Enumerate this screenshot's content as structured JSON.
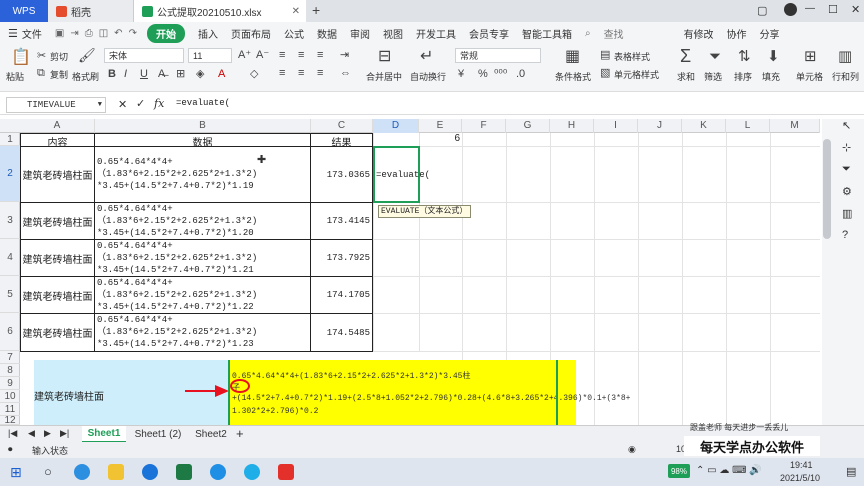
{
  "titlebar": {
    "wps_label": "WPS",
    "tab_daoke": "稻壳",
    "tab_file": "公式提取20210510.xlsx",
    "new_tab": "+",
    "win_ctrl_restore": "▢",
    "win_ctrl_min": "—",
    "win_ctrl_max": "☐",
    "win_ctrl_close": "✕"
  },
  "menubar": {
    "file": "文件",
    "items": [
      "开始",
      "插入",
      "页面布局",
      "公式",
      "数据",
      "审阅",
      "视图",
      "开发工具",
      "会员专享",
      "智能工具箱"
    ],
    "search": "查找",
    "right": [
      "有修改",
      "协作",
      "分享"
    ]
  },
  "ribbon": {
    "paste": "粘贴",
    "cut": "剪切",
    "copy": "复制",
    "format_painter": "格式刷",
    "font_name": "宋体",
    "font_size": "11",
    "merge": "合并居中",
    "wrap": "自动换行",
    "number_format": "常规",
    "table_style": "表格样式",
    "cond_format": "条件格式",
    "cell_style": "单元格样式",
    "sum": "求和",
    "filter": "筛选",
    "sort": "排序",
    "fill": "填充",
    "cell_fmt": "单元格",
    "row_col": "行和列"
  },
  "formula_bar": {
    "name_box": "TIMEVALUE",
    "formula": "=evaluate("
  },
  "columns": [
    "A",
    "B",
    "C",
    "D",
    "E",
    "F",
    "G",
    "H",
    "I",
    "J",
    "K",
    "L",
    "M"
  ],
  "rows": [
    "1",
    "2",
    "3",
    "4",
    "5",
    "6",
    "7",
    "8",
    "9",
    "10",
    "11",
    "12"
  ],
  "header_row": {
    "a": "内容",
    "b": "数据",
    "c": "结果",
    "e": "6"
  },
  "data_rows": [
    {
      "a": "建筑老砖墙柱面",
      "b1": "0.65*4.64*4*4+",
      "b2": "（1.83*6+2.15*2+2.625*2+1.3*2)",
      "b3": "*3.45+(14.5*2+7.4+0.7*2)*1.19",
      "c": "173.0365"
    },
    {
      "a": "建筑老砖墙柱面",
      "b1": "0.65*4.64*4*4+",
      "b2": "（1.83*6+2.15*2+2.625*2+1.3*2)",
      "b3": "*3.45+(14.5*2+7.4+0.7*2)*1.20",
      "c": "173.4145"
    },
    {
      "a": "建筑老砖墙柱面",
      "b1": "0.65*4.64*4*4+",
      "b2": "（1.83*6+2.15*2+2.625*2+1.3*2)",
      "b3": "*3.45+(14.5*2+7.4+0.7*2)*1.21",
      "c": "173.7925"
    },
    {
      "a": "建筑老砖墙柱面",
      "b1": "0.65*4.64*4*4+",
      "b2": "（1.83*6+2.15*2+2.625*2+1.3*2)",
      "b3": "*3.45+(14.5*2+7.4+0.7*2)*1.22",
      "c": "174.1705"
    },
    {
      "a": "建筑老砖墙柱面",
      "b1": "0.65*4.64*4*4+",
      "b2": "（1.83*6+2.15*2+2.625*2+1.3*2)",
      "b3": "*3.45+(14.5*2+7.4+0.7*2)*1.23",
      "c": "174.5485"
    }
  ],
  "d2_edit": "=evaluate(",
  "tooltip": "EVALUATE（文本公式）",
  "overlay": {
    "left_label": "建筑老砖墙柱面",
    "line1": "0.65*4.64*4*4+(1.83*6+2.15*2+2.625*2+1.3*2)*3.45柱",
    "line2": "子",
    "line3": "+(14.5*2+7.4+0.7*2)*1.19+(2.5*8+1.052*2+2.796)*0.28+(4.6*8+3.265*2+4.396)*0.1+(3*8+",
    "line4": "1.302*2+2.796)*0.2"
  },
  "sheets": [
    "Sheet1",
    "Sheet1 (2)",
    "Sheet2"
  ],
  "add_sheet": "+",
  "status": {
    "left": "输入状态",
    "page": "10"
  },
  "watermark": {
    "small": "跟盖老师  每天进步一丢丢儿",
    "big": "每天学点办公软件"
  },
  "taskbar": {
    "battery": "98%",
    "time": "19:41",
    "date": "2021/5/10"
  },
  "colors": {
    "accent_green": "#1e9e56",
    "wps_blue": "#2b62d9",
    "highlight_yellow": "#ffff00",
    "overlay_cyan": "#cdeefa",
    "arrow_red": "#e8111f"
  }
}
